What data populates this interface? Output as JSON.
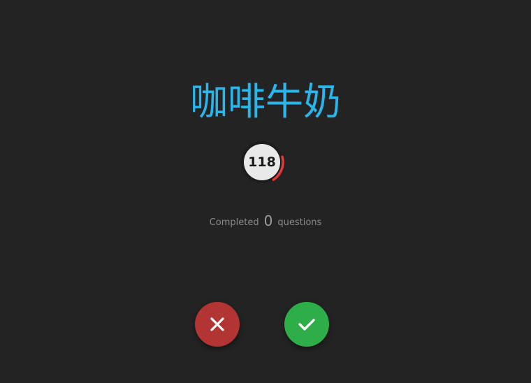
{
  "card": {
    "word": "咖啡牛奶"
  },
  "timer": {
    "value": "118",
    "ring_color": "#e53935",
    "remaining_fraction": 0.2
  },
  "progress": {
    "prefix": "Completed",
    "count": "0",
    "suffix": "questions"
  },
  "actions": {
    "wrong_icon": "close-icon",
    "wrong_color": "#b23433",
    "right_icon": "check-icon",
    "right_color": "#2eae49"
  },
  "colors": {
    "background": "#232323",
    "word": "#29b6ec"
  }
}
